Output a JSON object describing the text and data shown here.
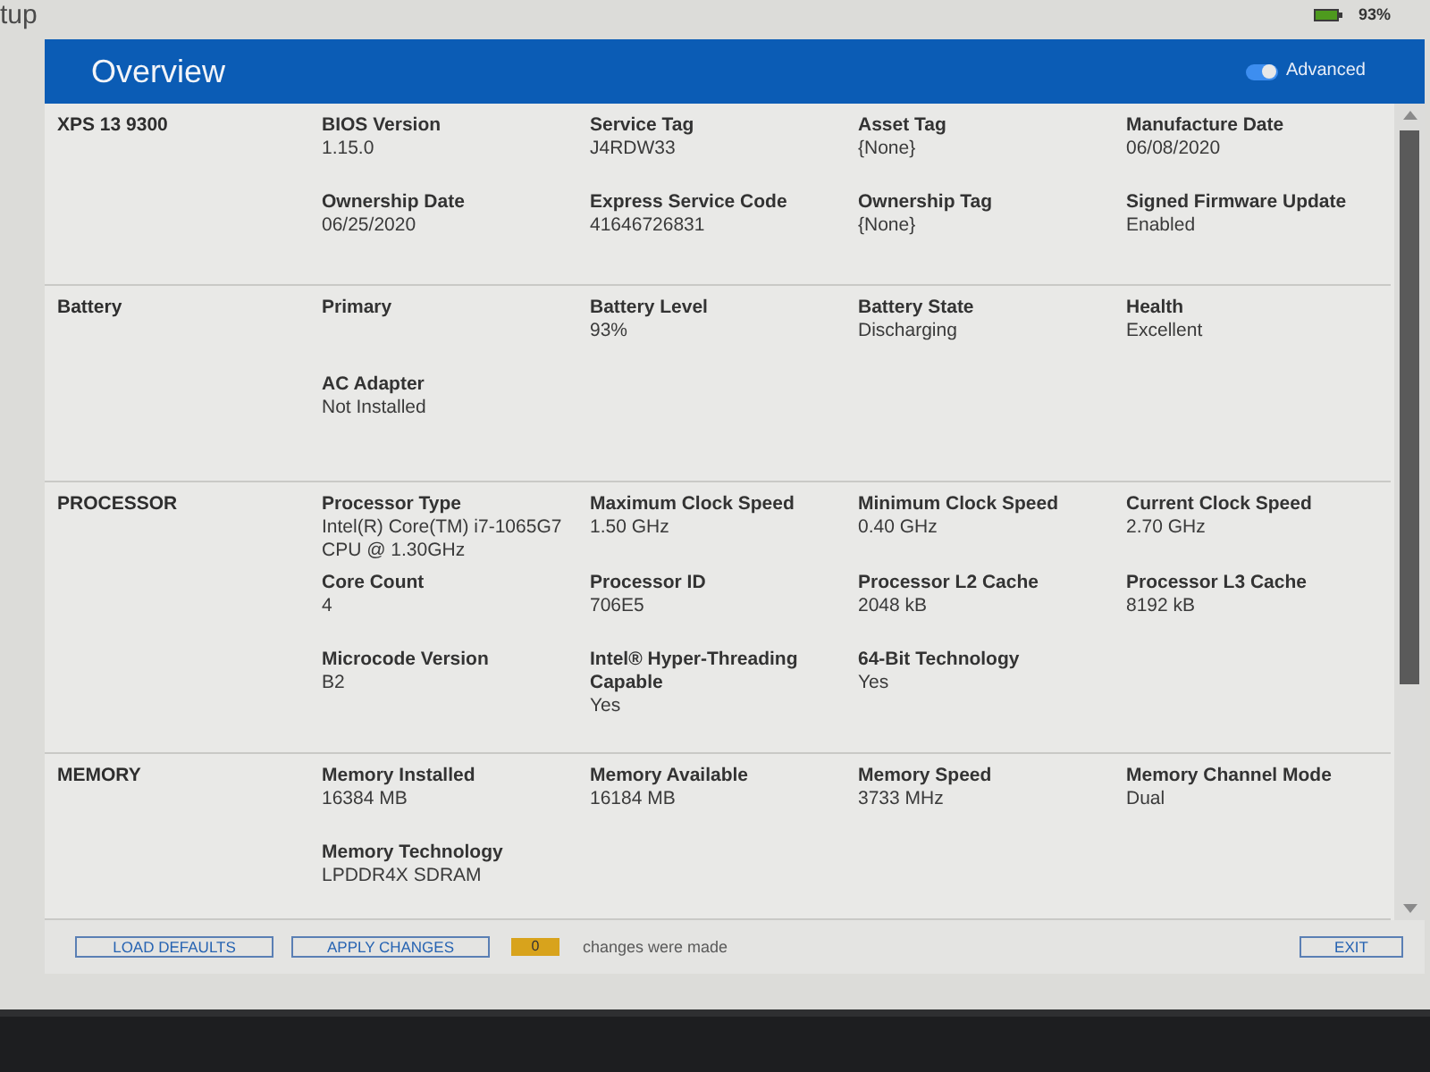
{
  "top_bar": {
    "title": "tup",
    "battery_reading": "93%"
  },
  "header": {
    "title": "Overview",
    "advanced_toggle": {
      "label": "Advanced",
      "on": true
    }
  },
  "sections": [
    {
      "name": "XPS 13 9300",
      "fields": [
        {
          "label": "BIOS Version",
          "value": "1.15.0"
        },
        {
          "label": "Service Tag",
          "value": "J4RDW33"
        },
        {
          "label": "Asset Tag",
          "value": "{None}"
        },
        {
          "label": "Manufacture Date",
          "value": "06/08/2020"
        },
        {
          "label": "Ownership Date",
          "value": "06/25/2020"
        },
        {
          "label": "Express Service Code",
          "value": "41646726831"
        },
        {
          "label": "Ownership Tag",
          "value": "{None}"
        },
        {
          "label": "Signed Firmware Update",
          "value": "Enabled"
        }
      ]
    },
    {
      "name": "Battery",
      "fields": [
        {
          "label": "Primary"
        },
        {
          "label": "Battery Level",
          "value": "93%"
        },
        {
          "label": "Battery State",
          "value": "Discharging"
        },
        {
          "label": "Health",
          "value": "Excellent"
        },
        {
          "label": "AC Adapter",
          "value": "Not Installed"
        }
      ]
    },
    {
      "name": "PROCESSOR",
      "fields": [
        {
          "label": "Processor Type",
          "value": "Intel(R) Core(TM) i7-1065G7 CPU @ 1.30GHz"
        },
        {
          "label": "Maximum Clock Speed",
          "value": "1.50 GHz"
        },
        {
          "label": "Minimum Clock Speed",
          "value": "0.40 GHz"
        },
        {
          "label": "Current Clock Speed",
          "value": "2.70 GHz"
        },
        {
          "label": "Core Count",
          "value": "4"
        },
        {
          "label": "Processor ID",
          "value": "706E5"
        },
        {
          "label": "Processor L2 Cache",
          "value": "2048 kB"
        },
        {
          "label": "Processor L3 Cache",
          "value": "8192 kB"
        },
        {
          "label": "Microcode Version",
          "value": "B2"
        },
        {
          "label": "Intel® Hyper-Threading Capable",
          "value": "Yes"
        },
        {
          "label": "64-Bit Technology",
          "value": "Yes"
        }
      ]
    },
    {
      "name": "MEMORY",
      "fields": [
        {
          "label": "Memory Installed",
          "value": "16384 MB"
        },
        {
          "label": "Memory Available",
          "value": "16184 MB"
        },
        {
          "label": "Memory Speed",
          "value": "3733 MHz"
        },
        {
          "label": "Memory Channel Mode",
          "value": "Dual"
        },
        {
          "label": "Memory Technology",
          "value": "LPDDR4X SDRAM"
        }
      ]
    }
  ],
  "footer": {
    "buttons": [
      {
        "label": "LOAD DEFAULTS"
      },
      {
        "label": "APPLY CHANGES"
      }
    ],
    "change_count": "0",
    "change_text": "changes were made",
    "exit": "EXIT"
  }
}
